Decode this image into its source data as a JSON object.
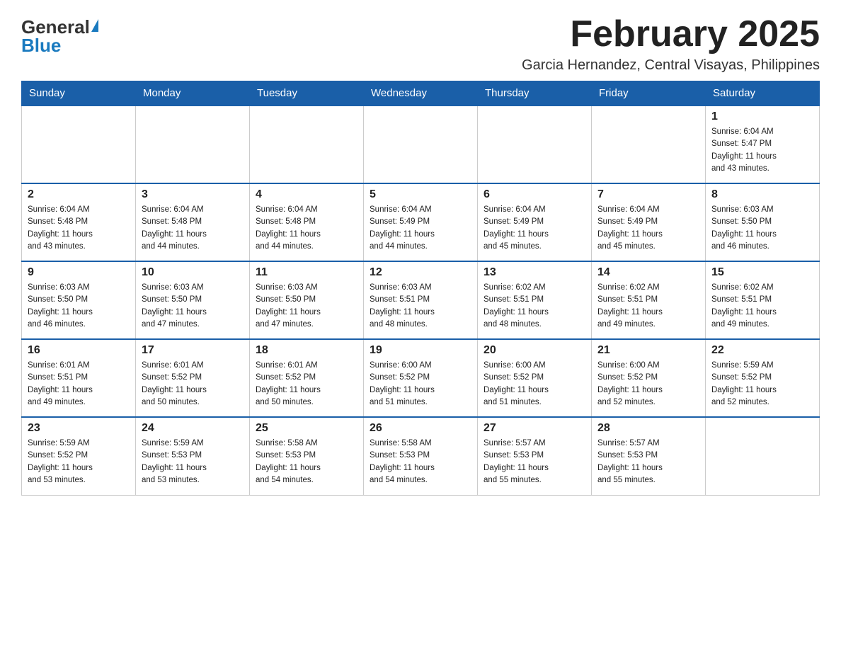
{
  "logo": {
    "general": "General",
    "blue": "Blue"
  },
  "title": "February 2025",
  "location": "Garcia Hernandez, Central Visayas, Philippines",
  "weekdays": [
    "Sunday",
    "Monday",
    "Tuesday",
    "Wednesday",
    "Thursday",
    "Friday",
    "Saturday"
  ],
  "weeks": [
    [
      {
        "day": "",
        "info": ""
      },
      {
        "day": "",
        "info": ""
      },
      {
        "day": "",
        "info": ""
      },
      {
        "day": "",
        "info": ""
      },
      {
        "day": "",
        "info": ""
      },
      {
        "day": "",
        "info": ""
      },
      {
        "day": "1",
        "info": "Sunrise: 6:04 AM\nSunset: 5:47 PM\nDaylight: 11 hours\nand 43 minutes."
      }
    ],
    [
      {
        "day": "2",
        "info": "Sunrise: 6:04 AM\nSunset: 5:48 PM\nDaylight: 11 hours\nand 43 minutes."
      },
      {
        "day": "3",
        "info": "Sunrise: 6:04 AM\nSunset: 5:48 PM\nDaylight: 11 hours\nand 44 minutes."
      },
      {
        "day": "4",
        "info": "Sunrise: 6:04 AM\nSunset: 5:48 PM\nDaylight: 11 hours\nand 44 minutes."
      },
      {
        "day": "5",
        "info": "Sunrise: 6:04 AM\nSunset: 5:49 PM\nDaylight: 11 hours\nand 44 minutes."
      },
      {
        "day": "6",
        "info": "Sunrise: 6:04 AM\nSunset: 5:49 PM\nDaylight: 11 hours\nand 45 minutes."
      },
      {
        "day": "7",
        "info": "Sunrise: 6:04 AM\nSunset: 5:49 PM\nDaylight: 11 hours\nand 45 minutes."
      },
      {
        "day": "8",
        "info": "Sunrise: 6:03 AM\nSunset: 5:50 PM\nDaylight: 11 hours\nand 46 minutes."
      }
    ],
    [
      {
        "day": "9",
        "info": "Sunrise: 6:03 AM\nSunset: 5:50 PM\nDaylight: 11 hours\nand 46 minutes."
      },
      {
        "day": "10",
        "info": "Sunrise: 6:03 AM\nSunset: 5:50 PM\nDaylight: 11 hours\nand 47 minutes."
      },
      {
        "day": "11",
        "info": "Sunrise: 6:03 AM\nSunset: 5:50 PM\nDaylight: 11 hours\nand 47 minutes."
      },
      {
        "day": "12",
        "info": "Sunrise: 6:03 AM\nSunset: 5:51 PM\nDaylight: 11 hours\nand 48 minutes."
      },
      {
        "day": "13",
        "info": "Sunrise: 6:02 AM\nSunset: 5:51 PM\nDaylight: 11 hours\nand 48 minutes."
      },
      {
        "day": "14",
        "info": "Sunrise: 6:02 AM\nSunset: 5:51 PM\nDaylight: 11 hours\nand 49 minutes."
      },
      {
        "day": "15",
        "info": "Sunrise: 6:02 AM\nSunset: 5:51 PM\nDaylight: 11 hours\nand 49 minutes."
      }
    ],
    [
      {
        "day": "16",
        "info": "Sunrise: 6:01 AM\nSunset: 5:51 PM\nDaylight: 11 hours\nand 49 minutes."
      },
      {
        "day": "17",
        "info": "Sunrise: 6:01 AM\nSunset: 5:52 PM\nDaylight: 11 hours\nand 50 minutes."
      },
      {
        "day": "18",
        "info": "Sunrise: 6:01 AM\nSunset: 5:52 PM\nDaylight: 11 hours\nand 50 minutes."
      },
      {
        "day": "19",
        "info": "Sunrise: 6:00 AM\nSunset: 5:52 PM\nDaylight: 11 hours\nand 51 minutes."
      },
      {
        "day": "20",
        "info": "Sunrise: 6:00 AM\nSunset: 5:52 PM\nDaylight: 11 hours\nand 51 minutes."
      },
      {
        "day": "21",
        "info": "Sunrise: 6:00 AM\nSunset: 5:52 PM\nDaylight: 11 hours\nand 52 minutes."
      },
      {
        "day": "22",
        "info": "Sunrise: 5:59 AM\nSunset: 5:52 PM\nDaylight: 11 hours\nand 52 minutes."
      }
    ],
    [
      {
        "day": "23",
        "info": "Sunrise: 5:59 AM\nSunset: 5:52 PM\nDaylight: 11 hours\nand 53 minutes."
      },
      {
        "day": "24",
        "info": "Sunrise: 5:59 AM\nSunset: 5:53 PM\nDaylight: 11 hours\nand 53 minutes."
      },
      {
        "day": "25",
        "info": "Sunrise: 5:58 AM\nSunset: 5:53 PM\nDaylight: 11 hours\nand 54 minutes."
      },
      {
        "day": "26",
        "info": "Sunrise: 5:58 AM\nSunset: 5:53 PM\nDaylight: 11 hours\nand 54 minutes."
      },
      {
        "day": "27",
        "info": "Sunrise: 5:57 AM\nSunset: 5:53 PM\nDaylight: 11 hours\nand 55 minutes."
      },
      {
        "day": "28",
        "info": "Sunrise: 5:57 AM\nSunset: 5:53 PM\nDaylight: 11 hours\nand 55 minutes."
      },
      {
        "day": "",
        "info": ""
      }
    ]
  ]
}
